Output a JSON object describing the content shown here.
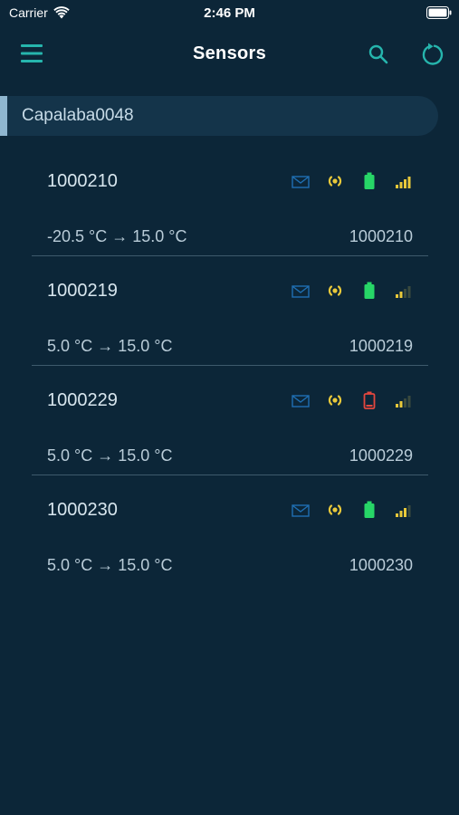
{
  "status_bar": {
    "carrier": "Carrier",
    "time": "2:46 PM"
  },
  "nav": {
    "title": "Sensors"
  },
  "group": {
    "name": "Capalaba0048"
  },
  "colors": {
    "accent": "#26b5ad",
    "mail": "#1f6fb3",
    "signal_live": "#e9c93a",
    "battery_ok": "#27d667",
    "battery_low": "#e3473e"
  },
  "sensors": [
    {
      "name": "1000210",
      "range": "-20.5 °C → 15.0 °C",
      "code": "1000210",
      "battery": "ok",
      "signal_bars": 4
    },
    {
      "name": "1000219",
      "range": "5.0 °C → 15.0 °C",
      "code": "1000219",
      "battery": "ok",
      "signal_bars": 2
    },
    {
      "name": "1000229",
      "range": "5.0 °C → 15.0 °C",
      "code": "1000229",
      "battery": "low",
      "signal_bars": 2
    },
    {
      "name": "1000230",
      "range": "5.0 °C → 15.0 °C",
      "code": "1000230",
      "battery": "ok",
      "signal_bars": 3
    }
  ]
}
